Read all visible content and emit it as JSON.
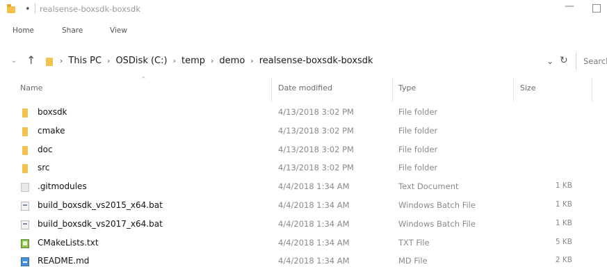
{
  "window": {
    "title": "realsense-boxsdk-boxsdk",
    "dot": "•",
    "minimize": "—"
  },
  "ribbon": {
    "tabs": [
      "Home",
      "Share",
      "View"
    ]
  },
  "address": {
    "crumbs": [
      "This PC",
      "OSDisk (C:)",
      "temp",
      "demo",
      "realsense-boxsdk-boxsdk"
    ],
    "separator": "›",
    "search_placeholder": "Search"
  },
  "columns": {
    "name": "Name",
    "date": "Date modified",
    "type": "Type",
    "size": "Size"
  },
  "files": [
    {
      "name": "boxsdk",
      "date": "4/13/2018 3:02 PM",
      "type": "File folder",
      "size": "",
      "icon": "folder-icon"
    },
    {
      "name": "cmake",
      "date": "4/13/2018 3:02 PM",
      "type": "File folder",
      "size": "",
      "icon": "folder-icon"
    },
    {
      "name": "doc",
      "date": "4/13/2018 3:02 PM",
      "type": "File folder",
      "size": "",
      "icon": "folder-icon"
    },
    {
      "name": "src",
      "date": "4/13/2018 3:02 PM",
      "type": "File folder",
      "size": "",
      "icon": "folder-icon"
    },
    {
      "name": ".gitmodules",
      "date": "4/4/2018 1:34 AM",
      "type": "Text Document",
      "size": "1 KB",
      "icon": "text-file-icon"
    },
    {
      "name": "build_boxsdk_vs2015_x64.bat",
      "date": "4/4/2018 1:34 AM",
      "type": "Windows Batch File",
      "size": "1 KB",
      "icon": "batch-file-icon"
    },
    {
      "name": "build_boxsdk_vs2017_x64.bat",
      "date": "4/4/2018 1:34 AM",
      "type": "Windows Batch File",
      "size": "1 KB",
      "icon": "batch-file-icon"
    },
    {
      "name": "CMakeLists.txt",
      "date": "4/4/2018 1:34 AM",
      "type": "TXT File",
      "size": "5 KB",
      "icon": "cmake-file-icon"
    },
    {
      "name": "README.md",
      "date": "4/4/2018 1:34 AM",
      "type": "MD File",
      "size": "2 KB",
      "icon": "markdown-file-icon"
    }
  ]
}
